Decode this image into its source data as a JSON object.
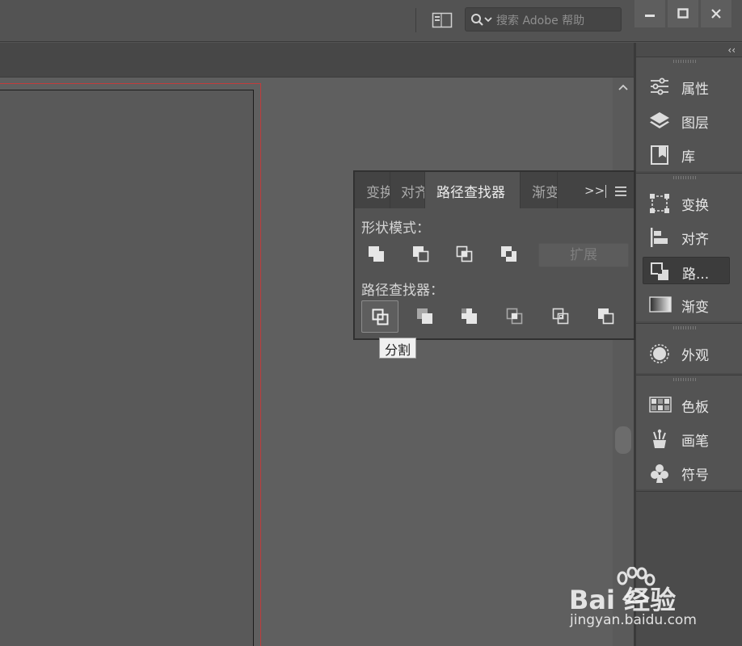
{
  "titlebar": {
    "search_placeholder": "搜索 Adobe 帮助"
  },
  "dock": {
    "collapse_glyph": "‹‹",
    "groups": [
      {
        "items": [
          {
            "label": "属性",
            "icon": "sliders-icon"
          },
          {
            "label": "图层",
            "icon": "layers-icon"
          },
          {
            "label": "库",
            "icon": "library-icon"
          }
        ]
      },
      {
        "items": [
          {
            "label": "变换",
            "icon": "transform-icon"
          },
          {
            "label": "对齐",
            "icon": "align-icon"
          },
          {
            "label": "路...",
            "icon": "pathfinder-icon",
            "active": true
          },
          {
            "label": "渐变",
            "icon": "gradient-icon"
          }
        ]
      },
      {
        "items": [
          {
            "label": "外观",
            "icon": "appearance-icon"
          }
        ]
      },
      {
        "items": [
          {
            "label": "色板",
            "icon": "swatches-icon"
          },
          {
            "label": "画笔",
            "icon": "brush-icon"
          },
          {
            "label": "符号",
            "icon": "symbol-icon"
          }
        ]
      }
    ]
  },
  "panel": {
    "tabs": [
      {
        "label": "变换"
      },
      {
        "label": "对齐"
      },
      {
        "label": "路径查找器",
        "active": true
      },
      {
        "label": "渐变"
      }
    ],
    "more_glyph": ">>",
    "shape_modes_label": "形状模式：",
    "pathfinders_label": "路径查找器：",
    "expand_label": "扩展",
    "tooltip": "分割"
  },
  "watermark": {
    "brand": "Bai 经验",
    "url": "jingyan.baidu.com"
  },
  "colors": {
    "bleed_line": "#c13c3c",
    "canvas": "#5f5f5f",
    "chrome": "#535353"
  }
}
